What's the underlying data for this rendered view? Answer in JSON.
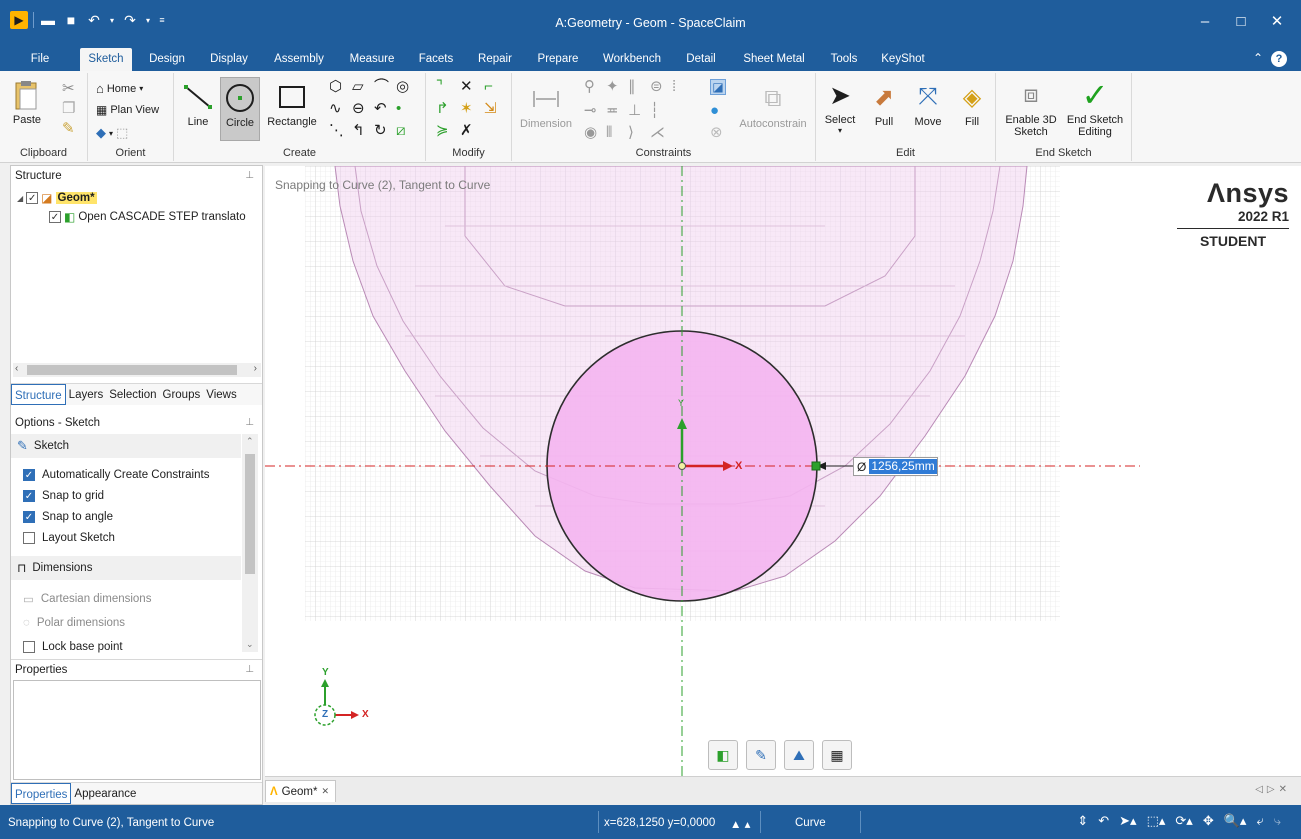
{
  "window": {
    "title": "A:Geometry - Geom - SpaceClaim",
    "controls": [
      "–",
      "□",
      "✕"
    ]
  },
  "ribbon_tabs": [
    "File",
    "Sketch",
    "Design",
    "Display",
    "Assembly",
    "Measure",
    "Facets",
    "Repair",
    "Prepare",
    "Workbench",
    "Detail",
    "Sheet Metal",
    "Tools",
    "KeyShot"
  ],
  "active_tab": "Sketch",
  "ribbon": {
    "clipboard": {
      "label": "Clipboard",
      "paste": "Paste"
    },
    "orient": {
      "label": "Orient",
      "home": "Home",
      "plan_view": "Plan View"
    },
    "create": {
      "label": "Create",
      "line": "Line",
      "circle": "Circle",
      "rectangle": "Rectangle"
    },
    "modify": {
      "label": "Modify"
    },
    "constraints": {
      "label": "Constraints",
      "dimension": "Dimension",
      "autoconstrain": "Autoconstrain"
    },
    "edit": {
      "label": "Edit",
      "select": "Select",
      "pull": "Pull",
      "move": "Move",
      "fill": "Fill"
    },
    "end_sketch": {
      "label": "End Sketch",
      "enable3d": "Enable 3D Sketch",
      "end_editing": "End Sketch Editing"
    }
  },
  "structure": {
    "title": "Structure",
    "root": "Geom*",
    "child": "Open CASCADE STEP translato"
  },
  "panel_tabs": [
    "Structure",
    "Layers",
    "Selection",
    "Groups",
    "Views"
  ],
  "options": {
    "title": "Options - Sketch",
    "section_sketch": "Sketch",
    "items": [
      {
        "label": "Automatically Create Constraints",
        "checked": true
      },
      {
        "label": "Snap to grid",
        "checked": true
      },
      {
        "label": "Snap to angle",
        "checked": true
      },
      {
        "label": "Layout Sketch",
        "checked": false
      }
    ],
    "section_dimensions": "Dimensions",
    "dim_items": [
      "Cartesian dimensions",
      "Polar dimensions"
    ],
    "lock_base_point": "Lock base point"
  },
  "properties": {
    "title": "Properties",
    "tabs": [
      "Properties",
      "Appearance"
    ]
  },
  "viewport": {
    "hint": "Snapping to Curve (2), Tangent to Curve",
    "brand": "Λnsys",
    "version": "2022 R1",
    "edition": "STUDENT",
    "axis_x": "X",
    "axis_y": "Y",
    "axis_z": "Z",
    "dimension_symbol": "Ø",
    "dimension_value": "1256,25mm"
  },
  "doc_tab": {
    "label": "Geom*",
    "close": "✕"
  },
  "statusbar": {
    "message": "Snapping to Curve (2), Tangent to Curve",
    "coords": "x=628,1250  y=0,0000",
    "mode": "Curve"
  },
  "colors": {
    "titlebar": "#1f5d9c",
    "sketch_fill": "#f4b5f0",
    "grid": "#d9d9d9",
    "axis_red": "#d42424",
    "axis_green": "#2ca02c"
  }
}
